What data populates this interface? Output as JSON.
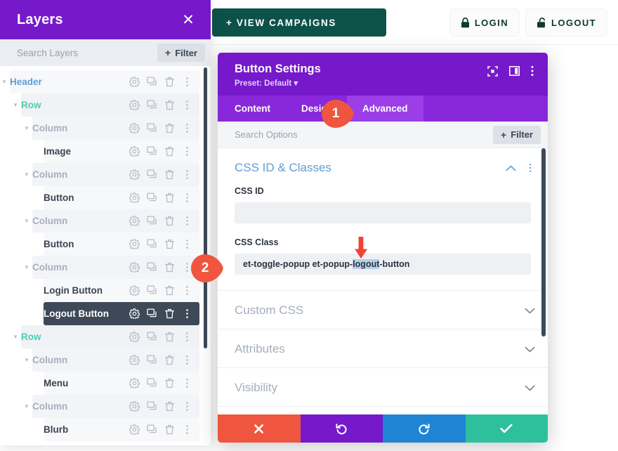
{
  "site": {
    "campaign_button": {
      "label": "+ VIEW CAMPAIGNS",
      "bg": "#0d5249",
      "text_color": "#ffffff"
    },
    "auth": [
      {
        "label": "LOGIN",
        "icon": "lock-closed-icon"
      },
      {
        "label": "LOGOUT",
        "icon": "lock-open-icon"
      }
    ]
  },
  "layers_panel": {
    "title": "Layers",
    "close_icon": "close-icon",
    "search": {
      "placeholder": "Search Layers"
    },
    "filter_button": {
      "label": "Filter",
      "icon": "plus-icon"
    },
    "row_icons": [
      "gear-icon",
      "duplicate-icon",
      "trash-icon",
      "more-vertical-icon"
    ],
    "items": [
      {
        "label": "Header",
        "type": "header",
        "depth": 0,
        "expanded": true,
        "active": false
      },
      {
        "label": "Row",
        "type": "row",
        "depth": 1,
        "expanded": true,
        "active": false
      },
      {
        "label": "Column",
        "type": "column",
        "depth": 2,
        "expanded": true,
        "active": false
      },
      {
        "label": "Image",
        "type": "module",
        "depth": 3,
        "expanded": false,
        "active": false
      },
      {
        "label": "Column",
        "type": "column",
        "depth": 2,
        "expanded": true,
        "active": false
      },
      {
        "label": "Button",
        "type": "module",
        "depth": 3,
        "expanded": false,
        "active": false
      },
      {
        "label": "Column",
        "type": "column",
        "depth": 2,
        "expanded": true,
        "active": false
      },
      {
        "label": "Button",
        "type": "module",
        "depth": 3,
        "expanded": false,
        "active": false
      },
      {
        "label": "Column",
        "type": "column",
        "depth": 2,
        "expanded": true,
        "active": false
      },
      {
        "label": "Login Button",
        "type": "module",
        "depth": 3,
        "expanded": false,
        "active": false
      },
      {
        "label": "Logout Button",
        "type": "module",
        "depth": 3,
        "expanded": false,
        "active": true
      },
      {
        "label": "Row",
        "type": "row",
        "depth": 1,
        "expanded": true,
        "active": false
      },
      {
        "label": "Column",
        "type": "column",
        "depth": 2,
        "expanded": true,
        "active": false
      },
      {
        "label": "Menu",
        "type": "module",
        "depth": 3,
        "expanded": false,
        "active": false
      },
      {
        "label": "Column",
        "type": "column",
        "depth": 2,
        "expanded": true,
        "active": false
      },
      {
        "label": "Blurb",
        "type": "module",
        "depth": 3,
        "expanded": false,
        "active": false
      }
    ]
  },
  "settings": {
    "title": "Button Settings",
    "preset": "Preset: Default",
    "header_icons": [
      "focus-target-icon",
      "panel-layout-icon",
      "more-vertical-icon"
    ],
    "tabs": [
      {
        "label": "Content",
        "active": false
      },
      {
        "label": "Design",
        "active": false
      },
      {
        "label": "Advanced",
        "active": true
      }
    ],
    "search": {
      "placeholder": "Search Options"
    },
    "filter_button": {
      "label": "Filter",
      "icon": "plus-icon"
    },
    "sections": [
      {
        "title": "CSS ID & Classes",
        "open": true,
        "collapse_icon": "chevron-up-icon",
        "menu_icon": "more-vertical-icon",
        "fields": [
          {
            "label": "CSS ID",
            "value": "",
            "placeholder": ""
          },
          {
            "label": "CSS Class",
            "value": "et-toggle-popup et-popup-logout-button",
            "value_pre": "et-toggle-popup et-popup-",
            "value_selected": "logout",
            "value_post": "-button"
          }
        ]
      },
      {
        "title": "Custom CSS",
        "open": false,
        "collapse_icon": "chevron-down-icon",
        "fields": []
      },
      {
        "title": "Attributes",
        "open": false,
        "collapse_icon": "chevron-down-icon",
        "fields": []
      },
      {
        "title": "Visibility",
        "open": false,
        "collapse_icon": "chevron-down-icon",
        "fields": []
      }
    ],
    "footer": [
      {
        "name": "cancel",
        "icon": "close-x-icon",
        "color": "#f0553f"
      },
      {
        "name": "undo",
        "icon": "undo-icon",
        "color": "#7519cb"
      },
      {
        "name": "redo",
        "icon": "redo-icon",
        "color": "#2084d4"
      },
      {
        "name": "save",
        "icon": "checkmark-icon",
        "color": "#2ec09c"
      }
    ]
  },
  "annotations": {
    "badges": [
      {
        "number": "1",
        "color": "#f0553f"
      },
      {
        "number": "2",
        "color": "#f0553f"
      }
    ],
    "arrow": {
      "direction": "down",
      "color": "#ef4332"
    }
  },
  "colors": {
    "brand_purple": "#7519cb",
    "tab_purple": "#8928da",
    "tab_active_purple": "#9b3ee8",
    "dark_slate": "#3e4958",
    "accent_red": "#f0553f",
    "green_dark": "#0d5249"
  }
}
